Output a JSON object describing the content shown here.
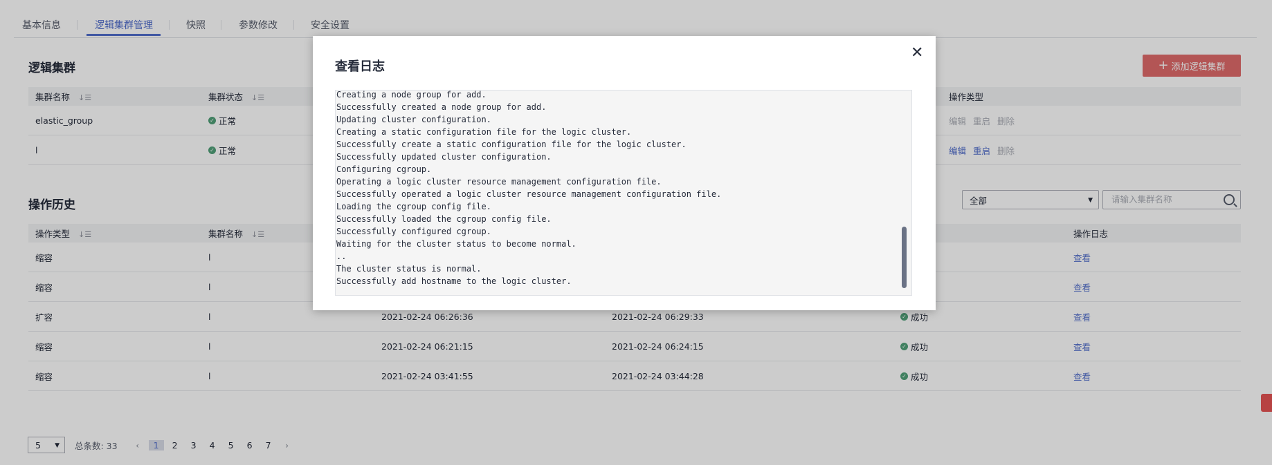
{
  "tabs": [
    "基本信息",
    "逻辑集群管理",
    "快照",
    "参数修改",
    "安全设置"
  ],
  "logic_cluster": {
    "title": "逻辑集群",
    "add_button": "添加逻辑集群",
    "columns": [
      "集群名称",
      "集群状态",
      "操作类型"
    ],
    "rows": [
      {
        "name": "elastic_group",
        "status": "正常",
        "ops": [
          "编辑",
          "重启",
          "删除"
        ],
        "ops_enabled": false
      },
      {
        "name": "l",
        "status": "正常",
        "ops": [
          "编辑",
          "重启",
          "删除"
        ],
        "ops_enabled": true
      }
    ]
  },
  "history": {
    "title": "操作历史",
    "filter_value": "全部",
    "search_placeholder": "请输入集群名称",
    "columns": [
      "操作类型",
      "集群名称",
      "",
      "",
      "",
      "操作日志"
    ],
    "rows": [
      {
        "type": "缩容",
        "name": "l",
        "start": "",
        "end": "",
        "result": "",
        "log": "查看"
      },
      {
        "type": "缩容",
        "name": "l",
        "start": "",
        "end": "",
        "result": "",
        "log": "查看"
      },
      {
        "type": "扩容",
        "name": "l",
        "start": "2021-02-24 06:26:36",
        "end": "2021-02-24 06:29:33",
        "result": "成功",
        "log": "查看"
      },
      {
        "type": "缩容",
        "name": "l",
        "start": "2021-02-24 06:21:15",
        "end": "2021-02-24 06:24:15",
        "result": "成功",
        "log": "查看"
      },
      {
        "type": "缩容",
        "name": "l",
        "start": "2021-02-24 03:41:55",
        "end": "2021-02-24 03:44:28",
        "result": "成功",
        "log": "查看"
      }
    ]
  },
  "pagination": {
    "page_size": "5",
    "total_label": "总条数: 33",
    "pages": [
      "1",
      "2",
      "3",
      "4",
      "5",
      "6",
      "7"
    ],
    "current": "1"
  },
  "modal": {
    "title": "查看日志",
    "log_lines": [
      "Creating a node group for add.",
      "Successfully created a node group for add.",
      "Updating cluster configuration.",
      "Creating a static configuration file for the logic cluster.",
      "Successfully create a static configuration file for the logic cluster.",
      "Successfully updated cluster configuration.",
      "Configuring cgroup.",
      "Operating a logic cluster resource management configuration file.",
      "Successfully operated a logic cluster resource management configuration file.",
      "Loading the cgroup config file.",
      "Successfully loaded the cgroup config file.",
      "Successfully configured cgroup.",
      "Waiting for the cluster status to become normal.",
      "..",
      "The cluster status is normal.",
      "Successfully add hostname to the logic cluster."
    ]
  },
  "colors": {
    "accent": "#526ecc",
    "danger": "#e06b6b",
    "success": "#50a079"
  }
}
